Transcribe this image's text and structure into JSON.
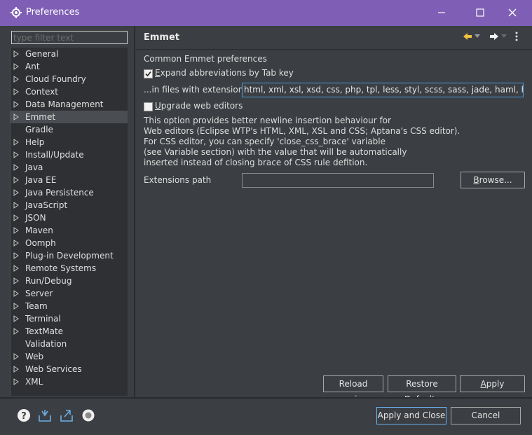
{
  "window": {
    "title": "Preferences",
    "accent_color": "#7e5fb5",
    "controls": [
      "minimize-icon",
      "maximize-icon",
      "close-icon"
    ]
  },
  "sidebar": {
    "filter_placeholder": "type filter text",
    "items": [
      {
        "label": "General",
        "expandable": true
      },
      {
        "label": "Ant",
        "expandable": true
      },
      {
        "label": "Cloud Foundry",
        "expandable": true
      },
      {
        "label": "Context",
        "expandable": true
      },
      {
        "label": "Data Management",
        "expandable": true
      },
      {
        "label": "Emmet",
        "expandable": true,
        "selected": true
      },
      {
        "label": "Gradle",
        "expandable": false
      },
      {
        "label": "Help",
        "expandable": true
      },
      {
        "label": "Install/Update",
        "expandable": true
      },
      {
        "label": "Java",
        "expandable": true
      },
      {
        "label": "Java EE",
        "expandable": true
      },
      {
        "label": "Java Persistence",
        "expandable": true
      },
      {
        "label": "JavaScript",
        "expandable": true
      },
      {
        "label": "JSON",
        "expandable": true
      },
      {
        "label": "Maven",
        "expandable": true
      },
      {
        "label": "Oomph",
        "expandable": true
      },
      {
        "label": "Plug-in Development",
        "expandable": true
      },
      {
        "label": "Remote Systems",
        "expandable": true
      },
      {
        "label": "Run/Debug",
        "expandable": true
      },
      {
        "label": "Server",
        "expandable": true
      },
      {
        "label": "Team",
        "expandable": true
      },
      {
        "label": "Terminal",
        "expandable": true
      },
      {
        "label": "TextMate",
        "expandable": true
      },
      {
        "label": "Validation",
        "expandable": false
      },
      {
        "label": "Web",
        "expandable": true
      },
      {
        "label": "Web Services",
        "expandable": true
      },
      {
        "label": "XML",
        "expandable": true
      }
    ]
  },
  "page": {
    "title": "Emmet",
    "nav_icons": [
      "back-arrow-icon",
      "back-dropdown-icon",
      "forward-arrow-icon",
      "forward-dropdown-icon",
      "more-vertical-icon"
    ],
    "section_label": "Common Emmet preferences",
    "expand_checkbox": {
      "label_first": "E",
      "label_rest": "xpand abbreviations by Tab key",
      "checked": true
    },
    "extensions_label": "...in files with extensions",
    "extensions_value": "html, xml, xsl, xsd, css, php, tpl, less, styl, scss, sass, jade, haml, hbs, twig",
    "upgrade_checkbox": {
      "label_first": "U",
      "label_rest": "pgrade web editors",
      "checked": false
    },
    "description": [
      "This option provides better newline insertion behaviour for",
      "Web editors (Eclipse WTP's HTML, XML, XSL and CSS; Aptana's CSS editor).",
      "For CSS editor, you can specify 'close_css_brace' variable",
      "(see Variable section) with the value that will be automatically",
      "inserted instead of closing brace of CSS rule defition."
    ],
    "path_label": "Extensions path",
    "path_value": "",
    "browse_button": {
      "first": "B",
      "rest": "rowse..."
    },
    "reload_button": "Reload engine",
    "restore_button": {
      "before": "Restore ",
      "key": "D",
      "after": "efaults"
    },
    "apply_button": {
      "key": "A",
      "rest": "pply"
    }
  },
  "footer": {
    "icons": [
      "help-icon",
      "import-icon",
      "export-icon",
      "record-icon"
    ],
    "apply_close_button": "Apply and Close",
    "cancel_button": "Cancel"
  }
}
